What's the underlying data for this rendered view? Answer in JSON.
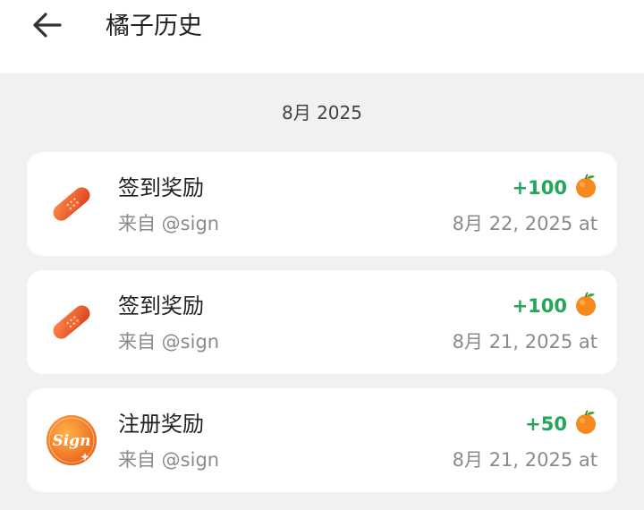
{
  "header": {
    "title": "橘子历史"
  },
  "month_label": "8月 2025",
  "colors": {
    "positive": "#22a65a",
    "background": "#f1f1f1",
    "card": "#ffffff"
  },
  "records": [
    {
      "name": "签到奖励",
      "source": "来自 @sign",
      "amount": "+100",
      "date": "8月 22, 2025 at",
      "icon": "bandage-icon",
      "currency_icon": "orange-icon"
    },
    {
      "name": "签到奖励",
      "source": "来自 @sign",
      "amount": "+100",
      "date": "8月 21, 2025 at",
      "icon": "bandage-icon",
      "currency_icon": "orange-icon"
    },
    {
      "name": "注册奖励",
      "source": "来自 @sign",
      "amount": "+50",
      "date": "8月 21, 2025 at",
      "icon": "sign-badge-icon",
      "currency_icon": "orange-icon"
    }
  ]
}
